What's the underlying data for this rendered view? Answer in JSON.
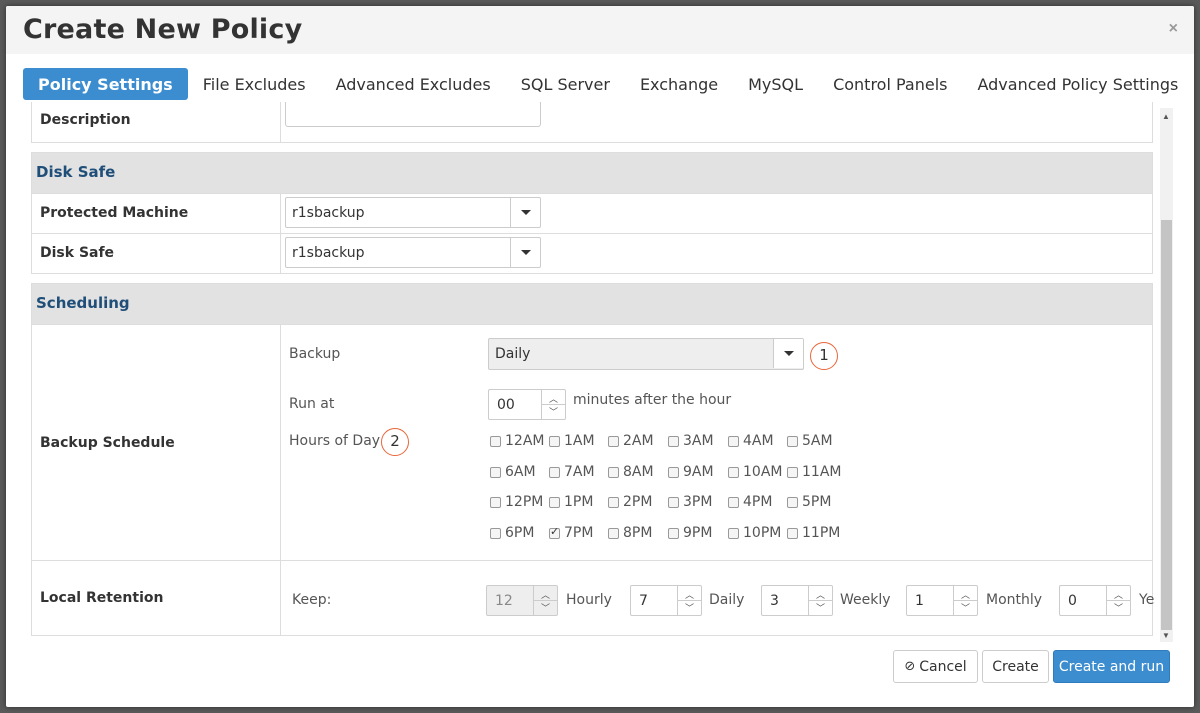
{
  "modal": {
    "title": "Create New Policy",
    "close": "×"
  },
  "tabs": [
    {
      "label": "Policy Settings",
      "active": true
    },
    {
      "label": "File Excludes"
    },
    {
      "label": "Advanced Excludes"
    },
    {
      "label": "SQL Server"
    },
    {
      "label": "Exchange"
    },
    {
      "label": "MySQL"
    },
    {
      "label": "Control Panels"
    },
    {
      "label": "Advanced Policy Settings"
    }
  ],
  "description": {
    "label": "Description",
    "value": ""
  },
  "disk_safe": {
    "header": "Disk Safe",
    "protected_machine": {
      "label": "Protected Machine",
      "value": "r1sbackup"
    },
    "disk_safe": {
      "label": "Disk Safe",
      "value": "r1sbackup"
    }
  },
  "scheduling": {
    "header": "Scheduling",
    "label": "Backup Schedule",
    "backup": {
      "label": "Backup",
      "value": "Daily",
      "badge": "1"
    },
    "run_at": {
      "label": "Run at",
      "value": "00",
      "suffix": "minutes after the hour"
    },
    "hours": {
      "label": "Hours of Day",
      "badge": "2"
    },
    "hour_rows": [
      [
        {
          "label": "12AM",
          "checked": false
        },
        {
          "label": "1AM",
          "checked": false
        },
        {
          "label": "2AM",
          "checked": false
        },
        {
          "label": "3AM",
          "checked": false
        },
        {
          "label": "4AM",
          "checked": false
        },
        {
          "label": "5AM",
          "checked": false
        }
      ],
      [
        {
          "label": "6AM",
          "checked": false
        },
        {
          "label": "7AM",
          "checked": false
        },
        {
          "label": "8AM",
          "checked": false
        },
        {
          "label": "9AM",
          "checked": false
        },
        {
          "label": "10AM",
          "checked": false
        },
        {
          "label": "11AM",
          "checked": false
        }
      ],
      [
        {
          "label": "12PM",
          "checked": false
        },
        {
          "label": "1PM",
          "checked": false
        },
        {
          "label": "2PM",
          "checked": false
        },
        {
          "label": "3PM",
          "checked": false
        },
        {
          "label": "4PM",
          "checked": false
        },
        {
          "label": "5PM",
          "checked": false
        }
      ],
      [
        {
          "label": "6PM",
          "checked": false
        },
        {
          "label": "7PM",
          "checked": true
        },
        {
          "label": "8PM",
          "checked": false
        },
        {
          "label": "9PM",
          "checked": false
        },
        {
          "label": "10PM",
          "checked": false
        },
        {
          "label": "11PM",
          "checked": false
        }
      ]
    ]
  },
  "retention": {
    "label": "Local Retention",
    "keep": "Keep:",
    "hourly": {
      "value": "12",
      "unit": "Hourly"
    },
    "daily": {
      "value": "7",
      "unit": "Daily"
    },
    "weekly": {
      "value": "3",
      "unit": "Weekly"
    },
    "monthly": {
      "value": "1",
      "unit": "Monthly"
    },
    "yearly": {
      "value": "0",
      "unit": "Ye"
    }
  },
  "footer": {
    "cancel": "Cancel",
    "create": "Create",
    "create_run": "Create and run"
  },
  "colors": {
    "primary": "#3c8dcf",
    "section_header": "#1f4e79",
    "badge_ring": "#e8663a"
  }
}
